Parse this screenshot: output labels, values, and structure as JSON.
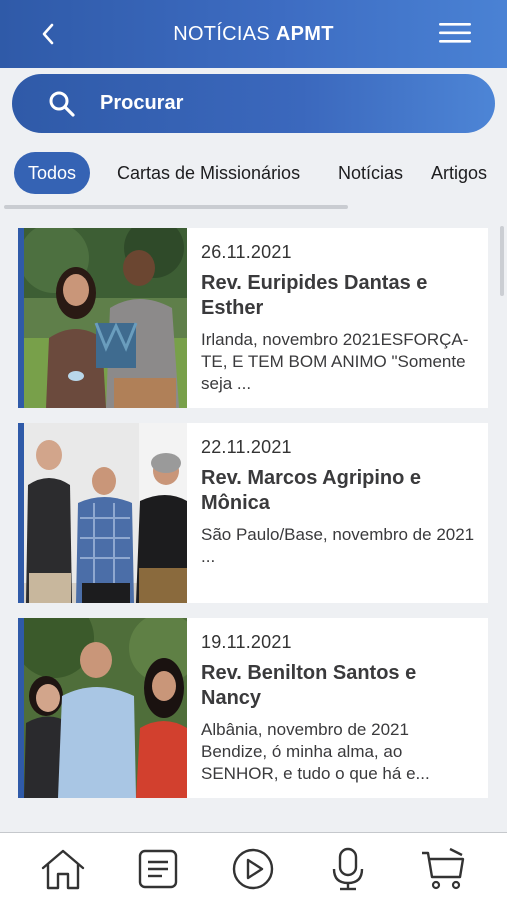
{
  "header": {
    "title_prefix": "NOTÍCIAS",
    "title_bold": "APMT",
    "back_icon": "chevron-left-icon",
    "menu_icon": "hamburger-menu-icon"
  },
  "search": {
    "label": "Procurar",
    "icon": "search-icon"
  },
  "tabs": [
    {
      "label": "Todos",
      "active": true
    },
    {
      "label": "Cartas de Missionários",
      "active": false
    },
    {
      "label": "Notícias",
      "active": false
    },
    {
      "label": "Artigos",
      "active": false
    }
  ],
  "cards": [
    {
      "date": "26.11.2021",
      "name": "Rev. Euripides Dantas e Esther",
      "excerpt": "Irlanda, novembro 2021ESFORÇA-TE, E TEM BOM ANIMO \"Somente seja ..."
    },
    {
      "date": "22.11.2021",
      "name": "Rev. Marcos Agripino e Mônica",
      "excerpt": "São Paulo/Base, novembro de 2021\n..."
    },
    {
      "date": "19.11.2021",
      "name": "Rev. Benilton Santos e Nancy",
      "excerpt": "Albânia, novembro de 2021 Bendize, ó minha alma, ao SENHOR, e tudo o que há e..."
    }
  ],
  "tabbar": [
    "home-icon",
    "document-icon",
    "play-icon",
    "microphone-icon",
    "cart-icon"
  ],
  "colors": {
    "brand": "#2f5aa8",
    "accent_bar": "#2f5aa8"
  }
}
